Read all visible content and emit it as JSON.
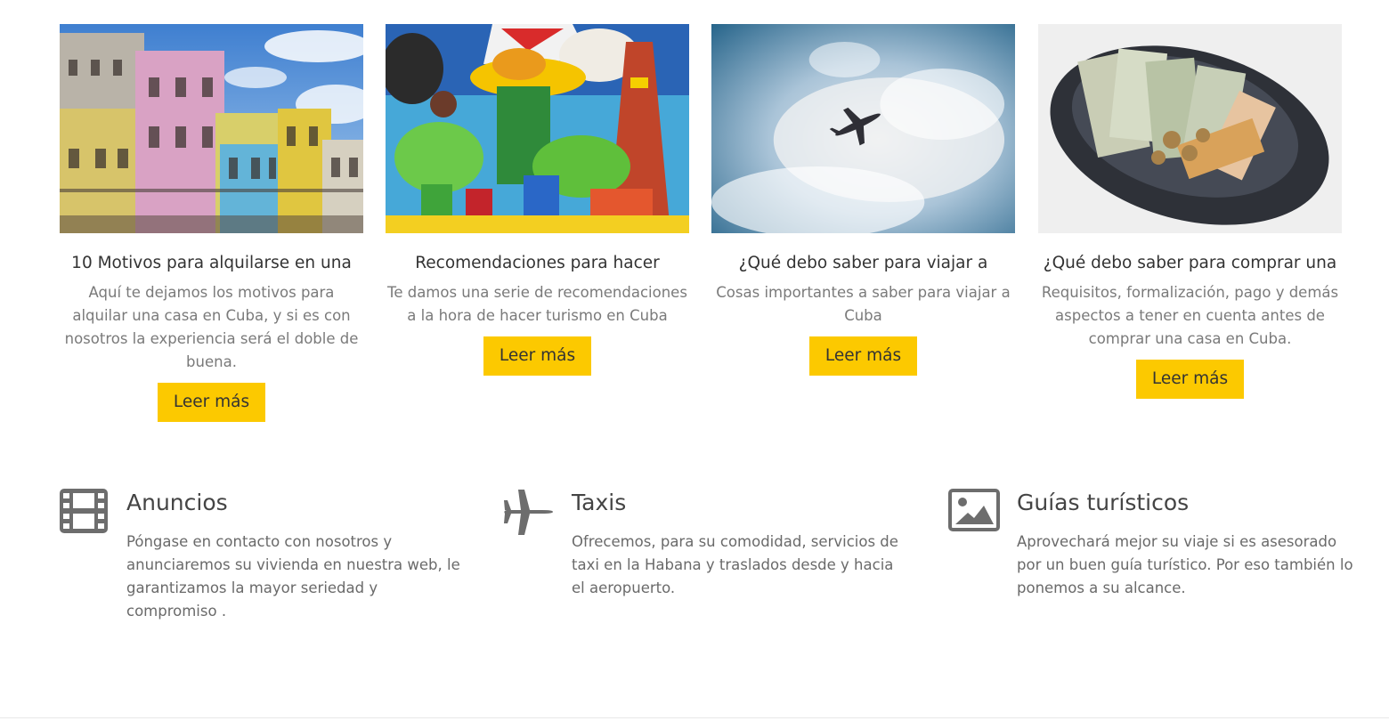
{
  "posts": [
    {
      "title": "10 Motivos para alquilarse en una",
      "excerpt": "Aquí te dejamos los motivos para alquilar una casa en Cuba, y si es con nosotros la experiencia será el doble de buena.",
      "button": "Leer más"
    },
    {
      "title": "Recomendaciones para hacer",
      "excerpt": "Te damos una serie de recomendaciones a la hora de hacer turismo en Cuba",
      "button": "Leer más"
    },
    {
      "title": "¿Qué debo saber para viajar a",
      "excerpt": "Cosas importantes a saber para viajar a Cuba",
      "button": "Leer más"
    },
    {
      "title": "¿Qué debo saber para comprar una",
      "excerpt": "Requisitos, formalización, pago y demás aspectos a tener en cuenta antes de comprar una casa en Cuba.",
      "button": "Leer más"
    }
  ],
  "services": [
    {
      "icon": "film-icon",
      "title": "Anuncios",
      "text": "Póngase en contacto con nosotros y anunciaremos su vivienda en nuestra web, le garantizamos la mayor seriedad y compromiso ."
    },
    {
      "icon": "plane-icon",
      "title": "Taxis",
      "text": "Ofrecemos, para su comodidad, servicios de taxi en la Habana y traslados desde y hacia el aeropuerto."
    },
    {
      "icon": "image-icon",
      "title": "Guías turísticos",
      "text": "Aprovechará mejor su viaje si es asesorado por un buen guía turístico. Por eso también lo ponemos a su alcance."
    }
  ],
  "colors": {
    "button_bg": "#fcc900",
    "icon": "#6d6d6d"
  }
}
